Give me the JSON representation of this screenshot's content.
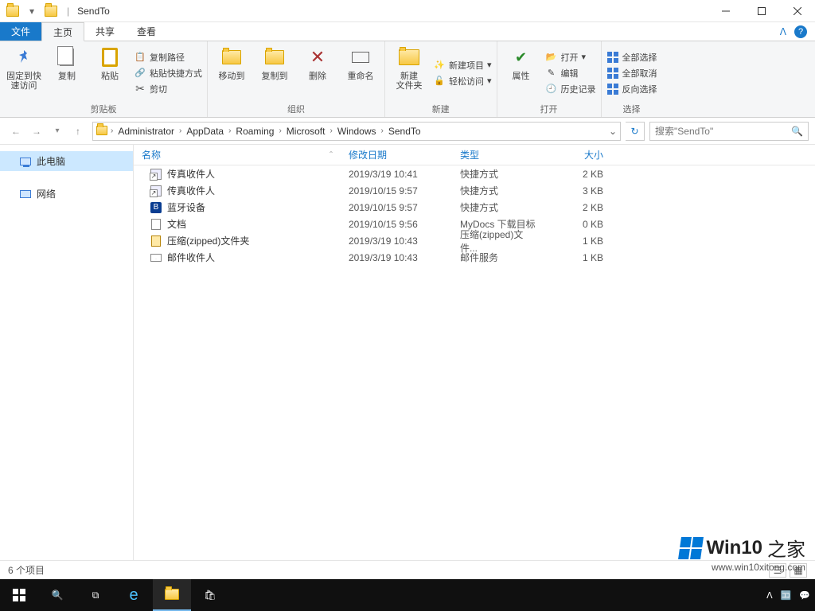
{
  "window_title": "SendTo",
  "tabs": {
    "file": "文件",
    "home": "主页",
    "share": "共享",
    "view": "查看"
  },
  "ribbon": {
    "clipboard": {
      "label": "剪贴板",
      "pin": "固定到快\n速访问",
      "copy": "复制",
      "paste": "粘贴",
      "copy_path": "复制路径",
      "paste_shortcut": "粘贴快捷方式",
      "cut": "剪切"
    },
    "organize": {
      "label": "组织",
      "move_to": "移动到",
      "copy_to": "复制到",
      "delete": "删除",
      "rename": "重命名"
    },
    "new": {
      "label": "新建",
      "new_folder": "新建\n文件夹",
      "new_item": "新建项目",
      "easy_access": "轻松访问"
    },
    "open": {
      "label": "打开",
      "properties": "属性",
      "open": "打开",
      "edit": "编辑",
      "history": "历史记录"
    },
    "select": {
      "label": "选择",
      "select_all": "全部选择",
      "select_none": "全部取消",
      "invert": "反向选择"
    }
  },
  "breadcrumb": [
    "Administrator",
    "AppData",
    "Roaming",
    "Microsoft",
    "Windows",
    "SendTo"
  ],
  "search_placeholder": "搜索\"SendTo\"",
  "sidebar": {
    "this_pc": "此电脑",
    "network": "网络"
  },
  "columns": {
    "name": "名称",
    "date": "修改日期",
    "type": "类型",
    "size": "大小"
  },
  "files": [
    {
      "icon": "shortcut",
      "name": "传真收件人",
      "date": "2019/3/19 10:41",
      "type": "快捷方式",
      "size": "2 KB"
    },
    {
      "icon": "shortcut",
      "name": "传真收件人",
      "date": "2019/10/15 9:57",
      "type": "快捷方式",
      "size": "3 KB"
    },
    {
      "icon": "bluetooth",
      "name": "蓝牙设备",
      "date": "2019/10/15 9:57",
      "type": "快捷方式",
      "size": "2 KB"
    },
    {
      "icon": "doc",
      "name": "文档",
      "date": "2019/10/15 9:56",
      "type": "MyDocs 下载目标",
      "size": "0 KB"
    },
    {
      "icon": "zip",
      "name": "压缩(zipped)文件夹",
      "date": "2019/3/19 10:43",
      "type": "压缩(zipped)文件...",
      "size": "1 KB"
    },
    {
      "icon": "mail",
      "name": "邮件收件人",
      "date": "2019/3/19 10:43",
      "type": "邮件服务",
      "size": "1 KB"
    }
  ],
  "status": "6 个项目",
  "watermark": {
    "brand": "Win10",
    "suffix": "之家",
    "url": "www.win10xitong.com"
  }
}
